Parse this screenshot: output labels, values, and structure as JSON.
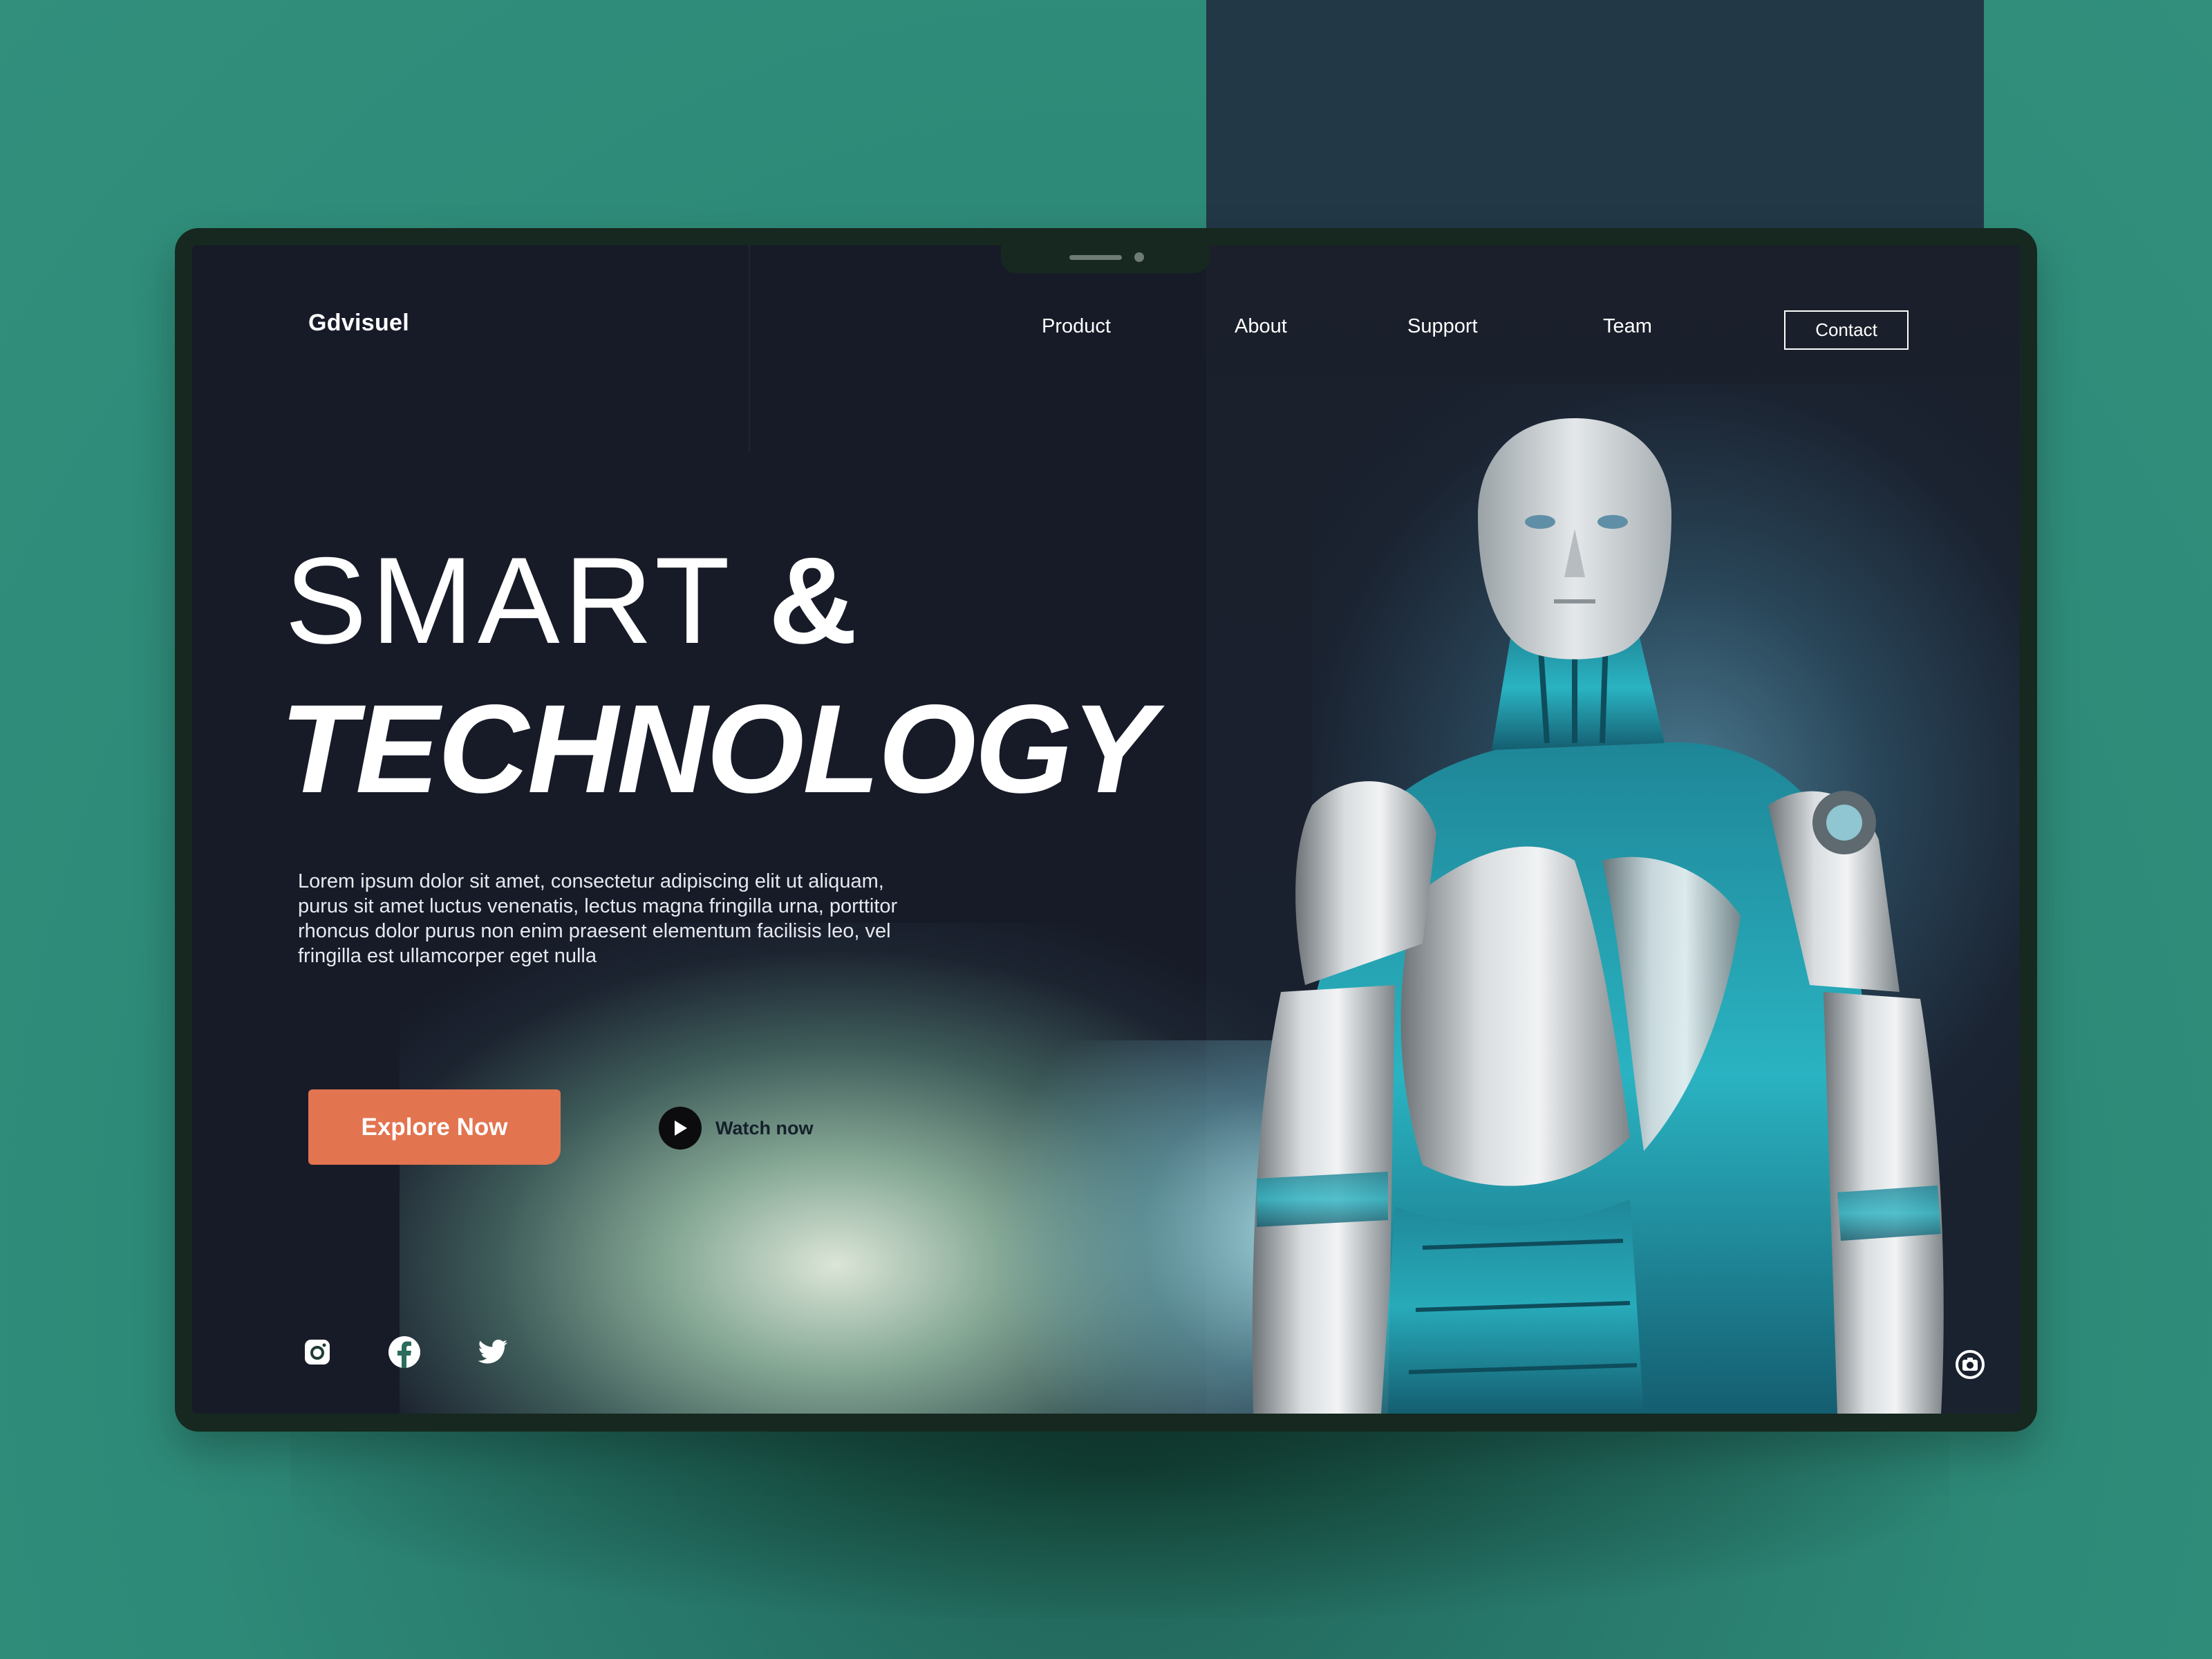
{
  "brand": {
    "name": "Gdvisuel"
  },
  "nav": {
    "items": [
      {
        "label": "Product"
      },
      {
        "label": "About"
      },
      {
        "label": "Support"
      },
      {
        "label": "Team"
      }
    ],
    "contact_label": "Contact"
  },
  "hero": {
    "line1_thin": "SMART",
    "line1_amp": "&",
    "line2": "TECHNOLOGY",
    "description": "Lorem ipsum dolor sit amet, consectetur adipiscing elit ut aliquam, purus sit amet luctus venenatis, lectus magna fringilla urna, porttitor rhoncus dolor purus non enim praesent elementum facilisis leo, vel fringilla est ullamcorper eget nulla",
    "primary_cta": "Explore Now",
    "secondary_cta": "Watch now"
  },
  "social": {
    "icons": [
      "instagram-icon",
      "facebook-icon",
      "twitter-icon"
    ]
  },
  "corner_icon": "camera-icon",
  "colors": {
    "page_background": "#318f7c",
    "accent_block": "#223846",
    "screen_background": "#171b28",
    "cta": "#e2744f",
    "text": "#ffffff"
  }
}
